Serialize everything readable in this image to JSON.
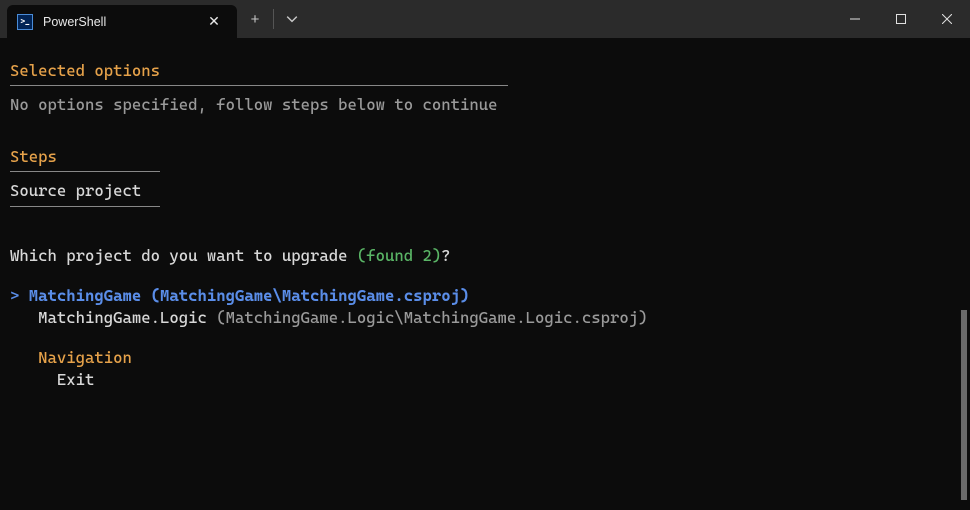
{
  "titlebar": {
    "tab_title": "PowerShell"
  },
  "terminal": {
    "selected_options": {
      "heading": "Selected options",
      "message": "No options specified, follow steps below to continue"
    },
    "steps": {
      "heading": "Steps",
      "current": "Source project"
    },
    "prompt": {
      "prefix": "Which project do you want to upgrade ",
      "found_text": "(found 2)",
      "suffix": "?"
    },
    "options": [
      {
        "selected": true,
        "name": "MatchingGame",
        "path": "(MatchingGame\\MatchingGame.csproj)"
      },
      {
        "selected": false,
        "name": "MatchingGame.Logic",
        "path": "(MatchingGame.Logic\\MatchingGame.Logic.csproj)"
      }
    ],
    "navigation": {
      "heading": "Navigation",
      "items": [
        "Exit"
      ]
    },
    "cursor_char": ">"
  }
}
